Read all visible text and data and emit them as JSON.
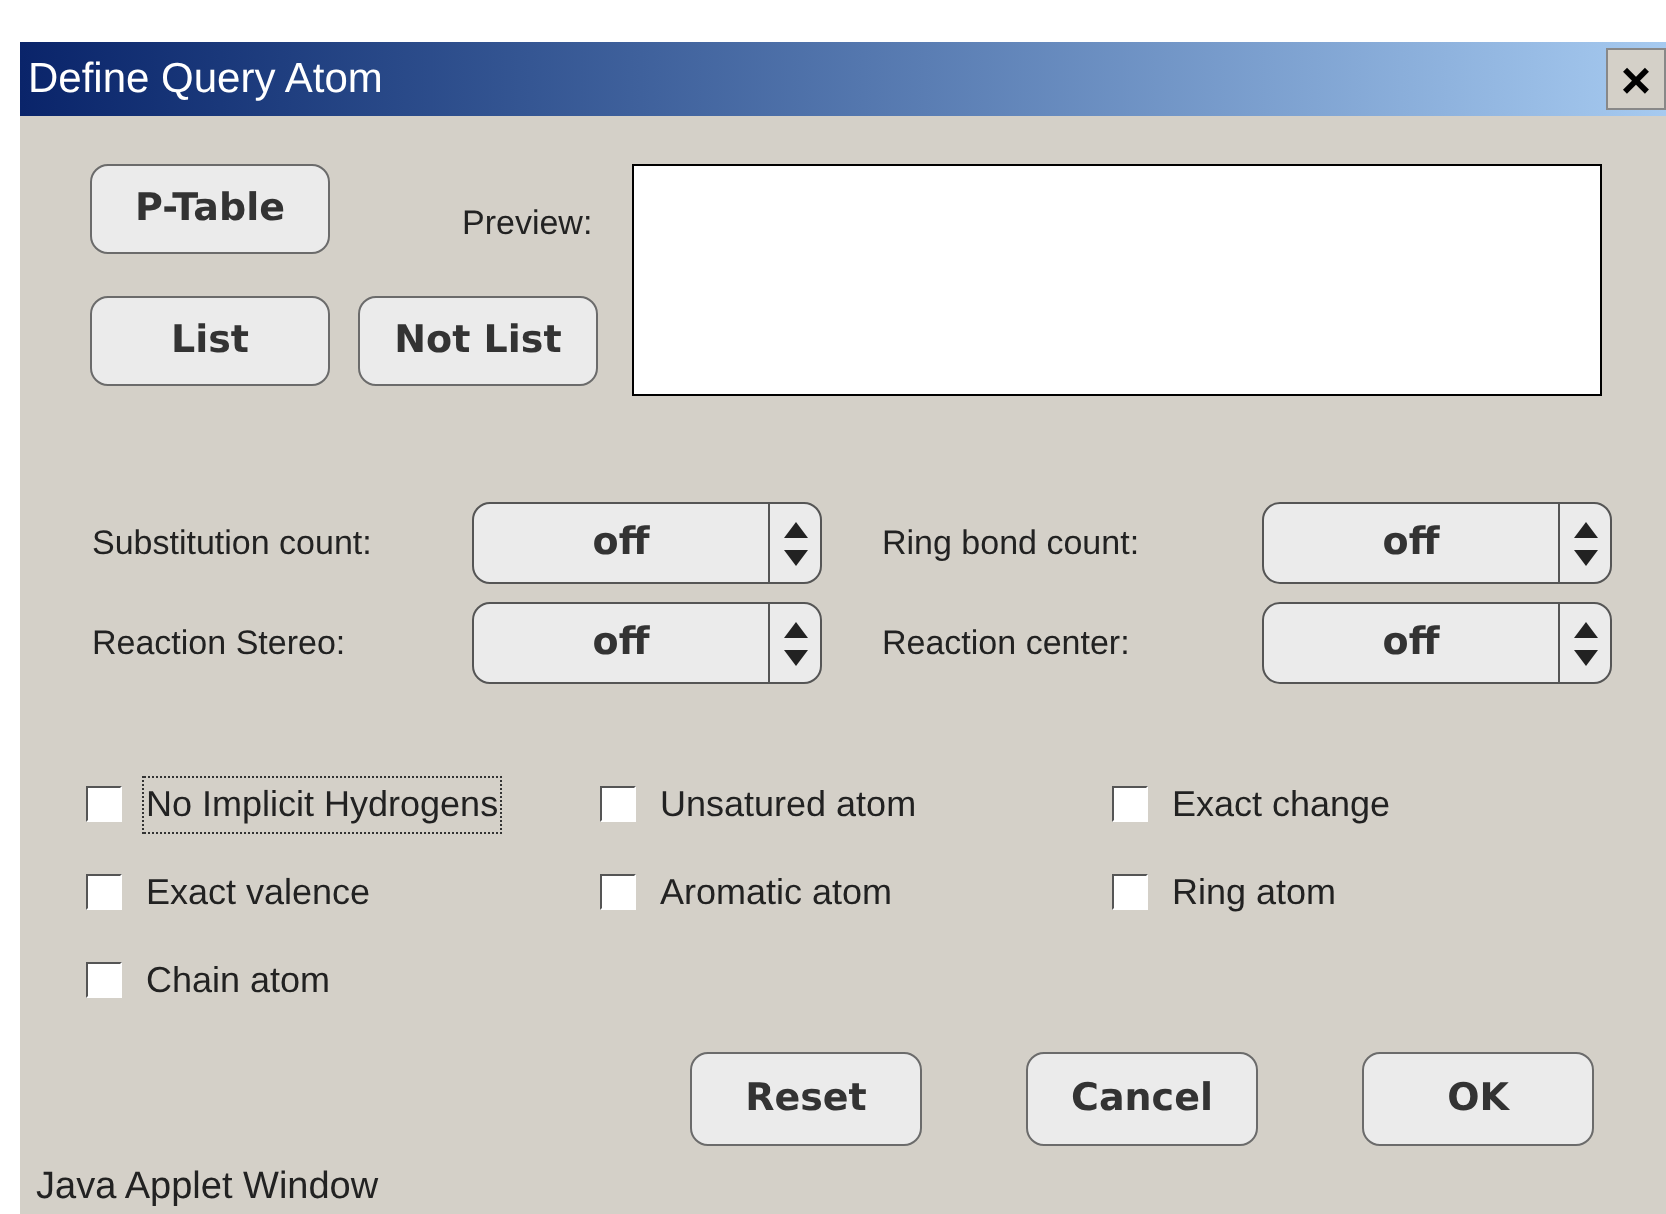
{
  "window": {
    "title": "Define Query Atom",
    "close": "×"
  },
  "element_buttons": [
    {
      "label": "P-Table"
    },
    {
      "label": "List"
    },
    {
      "label": "Not List"
    }
  ],
  "preview": {
    "label": "Preview:"
  },
  "spinners": [
    {
      "label": "Substitution count:",
      "value": "off"
    },
    {
      "label": "Ring bond count:",
      "value": "off"
    },
    {
      "label": "Reaction Stereo:",
      "value": "off"
    },
    {
      "label": "Reaction center:",
      "value": "off"
    }
  ],
  "checkboxes": [
    {
      "label": "No Implicit Hydrogens",
      "checked": false,
      "focused": true
    },
    {
      "label": "Unsatured atom",
      "checked": false,
      "focused": false
    },
    {
      "label": "Exact change",
      "checked": false,
      "focused": false
    },
    {
      "label": "Exact valence",
      "checked": false,
      "focused": false
    },
    {
      "label": "Aromatic atom",
      "checked": false,
      "focused": false
    },
    {
      "label": "Ring atom",
      "checked": false,
      "focused": false
    },
    {
      "label": "Chain atom",
      "checked": false,
      "focused": false
    }
  ],
  "buttons": [
    "Reset",
    "Cancel",
    "OK"
  ],
  "status_bar": "Java Applet Window"
}
